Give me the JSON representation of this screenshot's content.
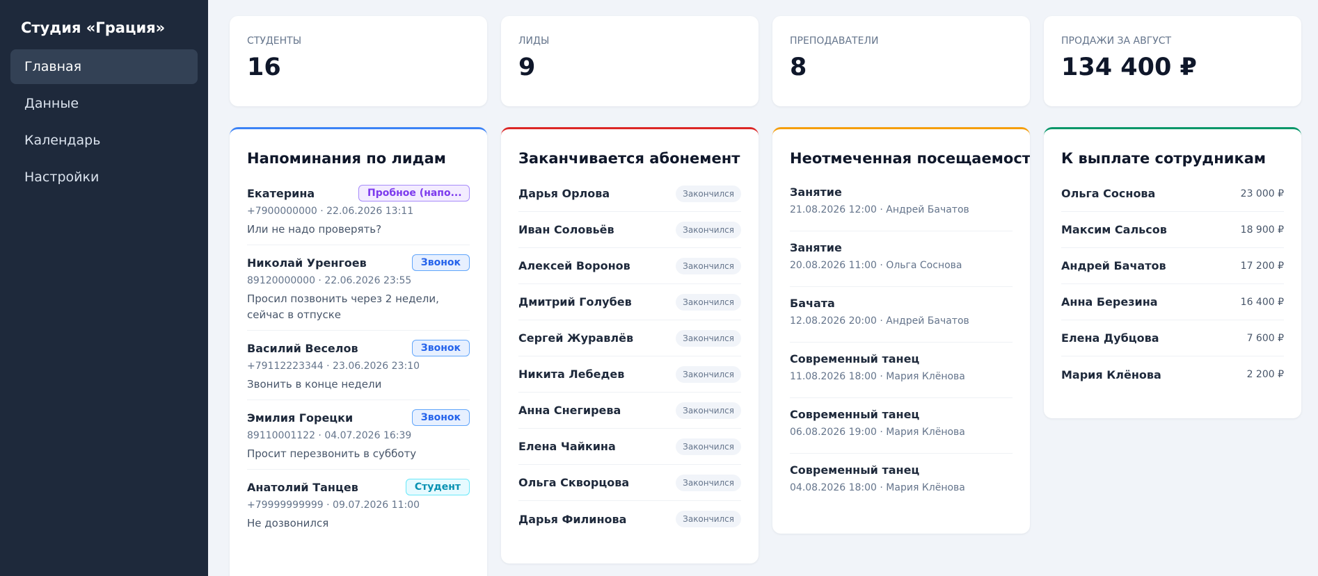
{
  "sidebar": {
    "brand": "Студия «Грация»",
    "items": [
      {
        "label": "Главная",
        "active": true
      },
      {
        "label": "Данные",
        "active": false
      },
      {
        "label": "Календарь",
        "active": false
      },
      {
        "label": "Настройки",
        "active": false
      }
    ]
  },
  "stats": [
    {
      "label": "Студенты",
      "value": "16"
    },
    {
      "label": "Лиды",
      "value": "9"
    },
    {
      "label": "Преподаватели",
      "value": "8"
    },
    {
      "label": "Продажи за август",
      "value": "134 400 ₽"
    }
  ],
  "panels": {
    "leads": {
      "title": "Напоминания по лидам",
      "accent": "#3b82f6",
      "items": [
        {
          "name": "Екатерина",
          "badge": "Пробное (напо...",
          "badge_type": "trial",
          "meta": "+7900000000 · 22.06.2026 13:11",
          "note": "Или не надо проверять?"
        },
        {
          "name": "Николай Уренгоев",
          "badge": "Звонок",
          "badge_type": "call",
          "meta": "89120000000 · 22.06.2026 23:55",
          "note": "Просил позвонить через 2 недели, сейчас в отпуске"
        },
        {
          "name": "Василий Веселов",
          "badge": "Звонок",
          "badge_type": "call",
          "meta": "+79112223344 · 23.06.2026 23:10",
          "note": "Звонить в конце недели"
        },
        {
          "name": "Эмилия Горецки",
          "badge": "Звонок",
          "badge_type": "call",
          "meta": "89110001122 · 04.07.2026 16:39",
          "note": "Просит перезвонить в субботу"
        },
        {
          "name": "Анатолий Танцев",
          "badge": "Студент",
          "badge_type": "student",
          "meta": "+79999999999 · 09.07.2026 11:00",
          "note": "Не дозвонился"
        }
      ]
    },
    "subscriptions": {
      "title": "Заканчивается абонемент",
      "accent": "#dc2626",
      "items": [
        {
          "name": "Дарья Орлова",
          "status": "Закончился"
        },
        {
          "name": "Иван Соловьёв",
          "status": "Закончился"
        },
        {
          "name": "Алексей Воронов",
          "status": "Закончился"
        },
        {
          "name": "Дмитрий Голубев",
          "status": "Закончился"
        },
        {
          "name": "Сергей Журавлёв",
          "status": "Закончился"
        },
        {
          "name": "Никита Лебедев",
          "status": "Закончился"
        },
        {
          "name": "Анна Снегирева",
          "status": "Закончился"
        },
        {
          "name": "Елена Чайкина",
          "status": "Закончился"
        },
        {
          "name": "Ольга Скворцова",
          "status": "Закончился"
        },
        {
          "name": "Дарья Филинова",
          "status": "Закончился"
        }
      ]
    },
    "attendance": {
      "title": "Неотмеченная посещаемость",
      "accent": "#f59e0b",
      "items": [
        {
          "title": "Занятие",
          "meta": "21.08.2026 12:00 · Андрей Бачатов"
        },
        {
          "title": "Занятие",
          "meta": "20.08.2026 11:00 · Ольга Соснова"
        },
        {
          "title": "Бачата",
          "meta": "12.08.2026 20:00 · Андрей Бачатов"
        },
        {
          "title": "Современный танец",
          "meta": "11.08.2026 18:00 · Мария Клёнова"
        },
        {
          "title": "Современный танец",
          "meta": "06.08.2026 19:00 · Мария Клёнова"
        },
        {
          "title": "Современный танец",
          "meta": "04.08.2026 18:00 · Мария Клёнова"
        }
      ]
    },
    "payouts": {
      "title": "К выплате сотрудникам",
      "accent": "#059669",
      "items": [
        {
          "name": "Ольга Соснова",
          "amount": "23 000 ₽"
        },
        {
          "name": "Максим Сальсов",
          "amount": "18 900 ₽"
        },
        {
          "name": "Андрей Бачатов",
          "amount": "17 200 ₽"
        },
        {
          "name": "Анна Березина",
          "amount": "16 400 ₽"
        },
        {
          "name": "Елена Дубцова",
          "amount": "7 600 ₽"
        },
        {
          "name": "Мария Клёнова",
          "amount": "2 200 ₽"
        }
      ]
    }
  }
}
